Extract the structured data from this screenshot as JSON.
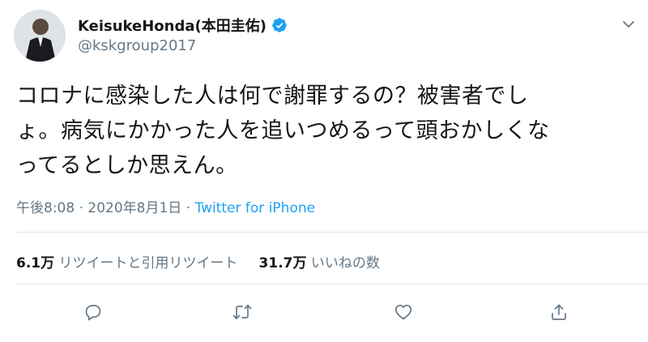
{
  "author": {
    "display_name": "KeisukeHonda(本田圭佑)",
    "handle": "@kskgroup2017",
    "verified": true,
    "avatar_icon": "profile-photo"
  },
  "tweet": {
    "lines": [
      "コロナに感染した人は何で謝罪するの？被害者でし",
      "ょ。病気にかかった人を追いつめるって頭おかしくな",
      "ってるとしか思えん。"
    ]
  },
  "meta": {
    "time": "午後8:08",
    "sep1": " · ",
    "date": "2020年8月1日",
    "sep2": " · ",
    "client": "Twitter for iPhone"
  },
  "stats": {
    "retweets_count": "6.1万",
    "retweets_label": "リツイートと引用リツイート",
    "likes_count": "31.7万",
    "likes_label": "いいねの数"
  },
  "icons": {
    "verified": "verified-badge-icon",
    "menu": "chevron-down-icon",
    "reply": "reply-icon",
    "retweet": "retweet-icon",
    "like": "heart-icon",
    "share": "share-icon"
  },
  "colors": {
    "accent": "#1da1f2",
    "text": "#14171a",
    "secondary": "#657786"
  }
}
